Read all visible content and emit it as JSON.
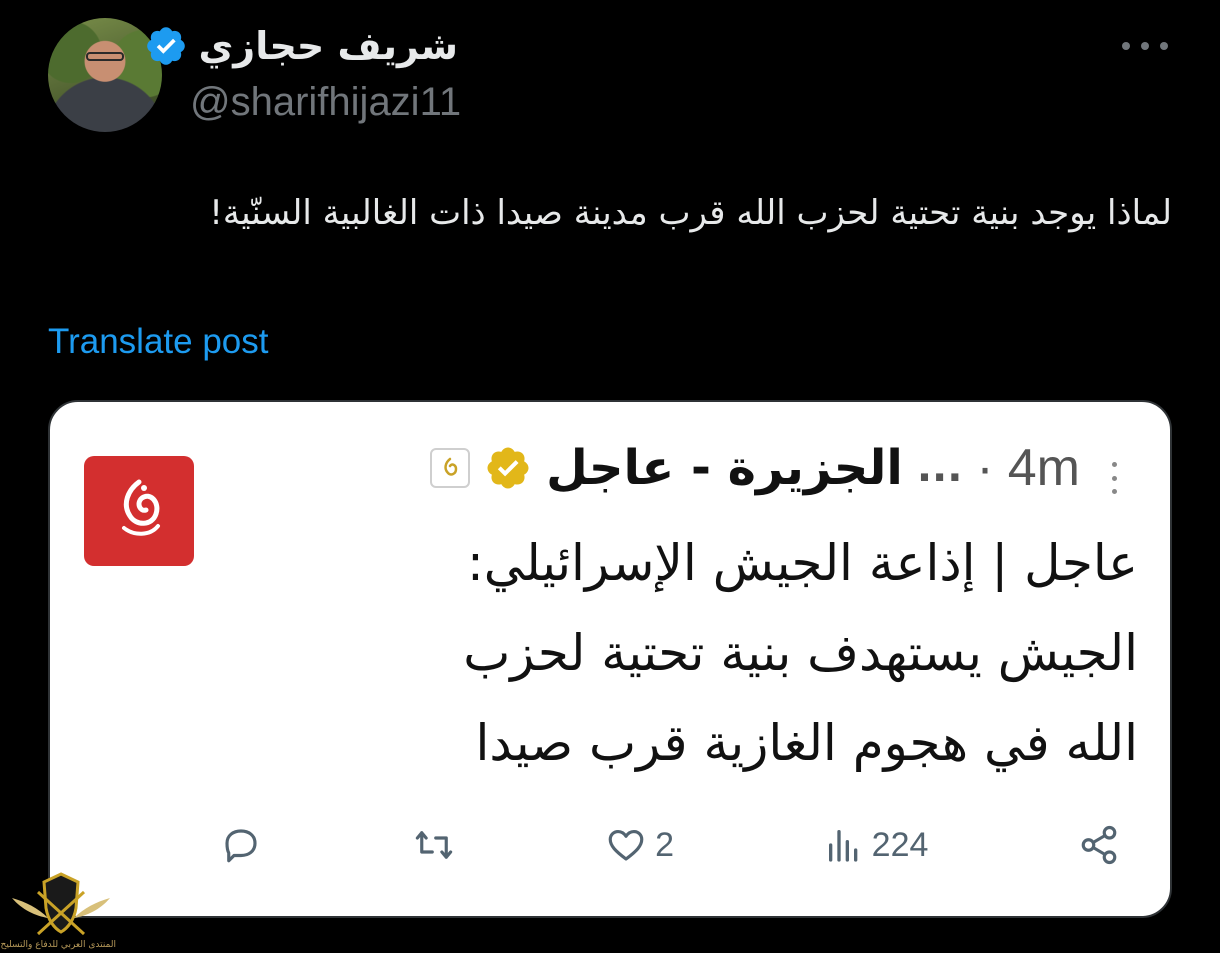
{
  "author": {
    "display_name": "شريف حجازي",
    "handle": "@sharifhijazi11",
    "verified": true
  },
  "post": {
    "text": "لماذا يوجد بنية تحتية لحزب الله قرب مدينة صيدا ذات الغالبية السنّية!",
    "translate_label": "Translate post"
  },
  "embedded_image": {
    "source_name": "الجزيرة - عاجل",
    "ellipsis": "...",
    "time": "4m",
    "separator": "·",
    "body_lines": [
      "عاجل | إذاعة الجيش الإسرائيلي:",
      "الجيش يستهدف بنية تحتية لحزب",
      "الله في هجوم الغازية قرب صيدا"
    ],
    "actions": {
      "likes": "2",
      "views": "224"
    }
  },
  "watermark": {
    "caption": "المنتدى العربي للدفاع والتسليح"
  },
  "colors": {
    "background": "#000000",
    "text": "#e7e9ea",
    "muted": "#71767b",
    "link": "#1d9bf0",
    "verified_blue": "#1d9bf0",
    "verified_gold": "#e2b719",
    "aljazeera_red": "#d32f2f"
  },
  "icons": {
    "verified": "verified-badge-icon",
    "more": "more-options-icon",
    "reply": "reply-icon",
    "repost": "repost-icon",
    "like": "heart-icon",
    "views": "bar-chart-icon",
    "share": "share-icon"
  }
}
